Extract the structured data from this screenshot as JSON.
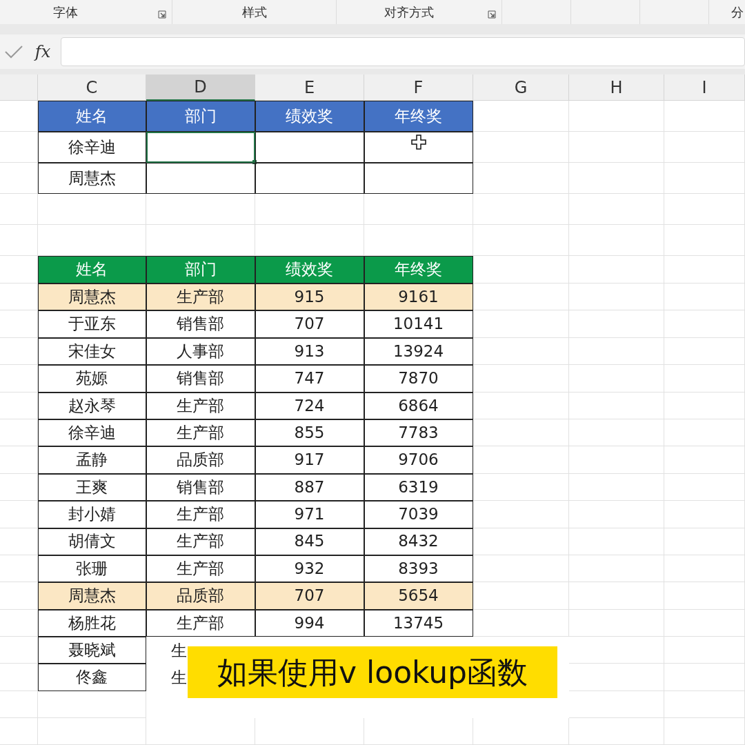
{
  "ribbon_groups": [
    {
      "label": "字体",
      "launcher": true
    },
    {
      "label": "样式",
      "launcher": false
    },
    {
      "label": "对齐方式",
      "launcher": true
    },
    {
      "label": "分",
      "launcher": false
    }
  ],
  "formula_bar": {
    "fx": "fx"
  },
  "column_headers": [
    {
      "label": "C",
      "selected": false
    },
    {
      "label": "D",
      "selected": true
    },
    {
      "label": "E",
      "selected": false
    },
    {
      "label": "F",
      "selected": false
    },
    {
      "label": "G",
      "selected": false
    },
    {
      "label": "H",
      "selected": false
    },
    {
      "label": "I",
      "selected": false
    }
  ],
  "lookup_table": {
    "columns": [
      "姓名",
      "部门",
      "绩效奖",
      "年终奖"
    ],
    "rows": [
      {
        "cells": [
          {
            "text": "徐辛迪",
            "selected": false
          },
          {
            "selected": true
          },
          {
            "selected": false
          },
          {
            "selected": false,
            "cursor": true
          }
        ]
      },
      {
        "cells": [
          {
            "text": "周慧杰",
            "selected": false
          },
          {
            "selected": false
          },
          {
            "selected": false
          },
          {
            "selected": false
          }
        ]
      }
    ]
  },
  "source_table": {
    "columns": [
      "姓名",
      "部门",
      "绩效奖",
      "年终奖"
    ],
    "rows": [
      {
        "highlighted": true,
        "cells": [
          "周慧杰",
          "生产部",
          "915",
          "9161"
        ]
      },
      {
        "highlighted": false,
        "cells": [
          "于亚东",
          "销售部",
          "707",
          "10141"
        ]
      },
      {
        "highlighted": false,
        "cells": [
          "宋佳女",
          "人事部",
          "913",
          "13924"
        ]
      },
      {
        "highlighted": false,
        "cells": [
          "苑嫄",
          "销售部",
          "747",
          "7870"
        ]
      },
      {
        "highlighted": false,
        "cells": [
          "赵永琴",
          "生产部",
          "724",
          "6864"
        ]
      },
      {
        "highlighted": false,
        "cells": [
          "徐辛迪",
          "生产部",
          "855",
          "7783"
        ]
      },
      {
        "highlighted": false,
        "cells": [
          "孟静",
          "品质部",
          "917",
          "9706"
        ]
      },
      {
        "highlighted": false,
        "cells": [
          "王爽",
          "销售部",
          "887",
          "6319"
        ]
      },
      {
        "highlighted": false,
        "cells": [
          "封小婧",
          "生产部",
          "971",
          "7039"
        ]
      },
      {
        "highlighted": false,
        "cells": [
          "胡倩文",
          "生产部",
          "845",
          "8432"
        ]
      },
      {
        "highlighted": false,
        "cells": [
          "张珊",
          "生产部",
          "932",
          "8393"
        ]
      },
      {
        "highlighted": true,
        "cells": [
          "周慧杰",
          "品质部",
          "707",
          "5654"
        ]
      },
      {
        "highlighted": false,
        "cells": [
          "杨胜花",
          "生产部",
          "994",
          "13745"
        ]
      },
      {
        "highlighted": false,
        "cells": [
          "聂晓斌",
          "生"
        ]
      },
      {
        "highlighted": false,
        "cells": [
          "佟鑫",
          "生"
        ]
      }
    ]
  },
  "caption": "如果使用v lookup函数"
}
